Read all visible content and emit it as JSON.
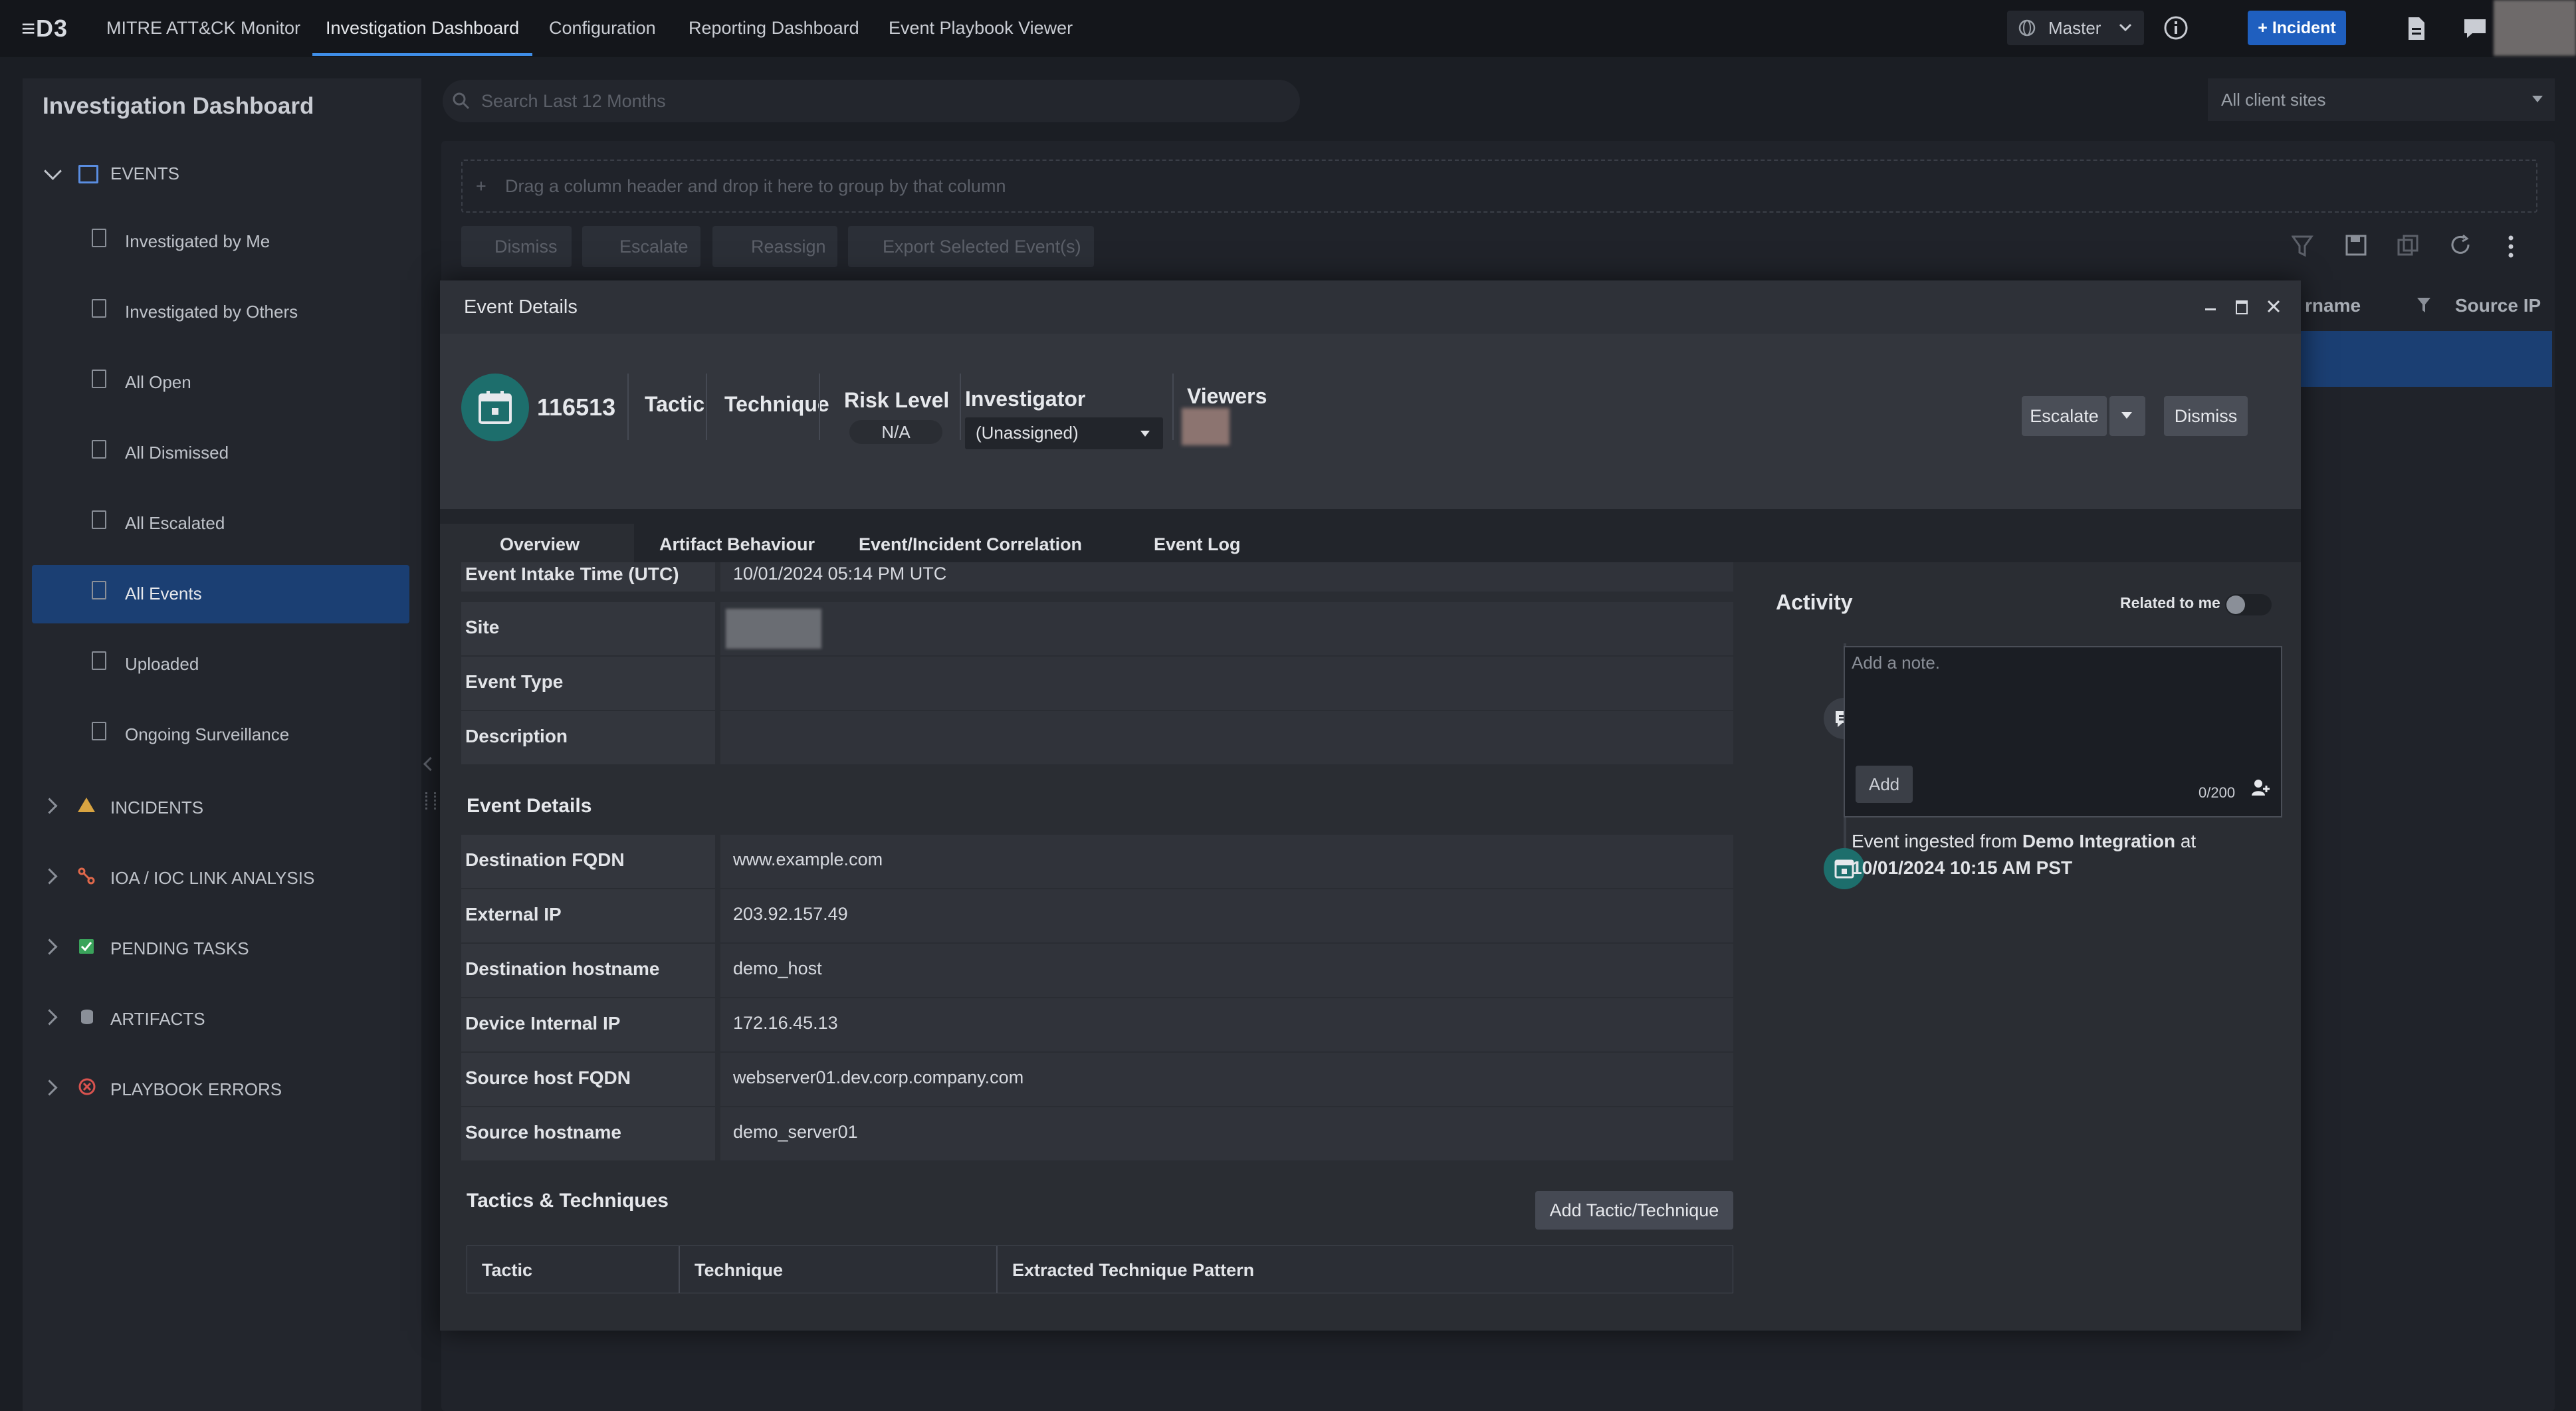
{
  "topbar": {
    "logo": "≡D3",
    "nav": [
      "MITRE ATT&CK Monitor",
      "Investigation Dashboard",
      "Configuration",
      "Reporting Dashboard",
      "Event Playbook Viewer"
    ],
    "master": "Master",
    "incident_button": "+ Incident"
  },
  "sidebar": {
    "title": "Investigation Dashboard",
    "events_section": "EVENTS",
    "items": [
      "Investigated by Me",
      "Investigated by Others",
      "All Open",
      "All Dismissed",
      "All Escalated",
      "All Events",
      "Uploaded",
      "Ongoing Surveillance"
    ],
    "sections": [
      "INCIDENTS",
      "IOA / IOC LINK ANALYSIS",
      "PENDING TASKS",
      "ARTIFACTS",
      "PLAYBOOK ERRORS"
    ]
  },
  "main": {
    "search_placeholder": "Search Last 12 Months",
    "client_sites": "All client sites",
    "dropzone": "Drag a column header and drop it here to group by that column",
    "toolbar": [
      "Dismiss",
      "Escalate",
      "Reassign",
      "Export Selected Event(s)"
    ],
    "col_headers": [
      "rname",
      "Source IP"
    ]
  },
  "modal": {
    "title": "Event Details",
    "event_id": "116513",
    "tactic_label": "Tactic",
    "technique_label": "Technique",
    "risk_label": "Risk Level",
    "risk_value": "N/A",
    "investigator_label": "Investigator",
    "investigator_value": "(Unassigned)",
    "viewers_label": "Viewers",
    "escalate": "Escalate",
    "dismiss": "Dismiss",
    "tabs": [
      "Overview",
      "Artifact Behaviour",
      "Event/Incident Correlation",
      "Event Log"
    ],
    "overview_rows": [
      {
        "label": "Event Intake Time (UTC)",
        "value": "10/01/2024 05:14 PM UTC"
      },
      {
        "label": "Site",
        "value": ""
      },
      {
        "label": "Event Type",
        "value": ""
      },
      {
        "label": "Description",
        "value": ""
      }
    ],
    "event_details_heading": "Event Details",
    "details_rows": [
      {
        "label": "Destination FQDN",
        "value": "www.example.com"
      },
      {
        "label": "External IP",
        "value": "203.92.157.49"
      },
      {
        "label": "Destination hostname",
        "value": "demo_host"
      },
      {
        "label": "Device Internal IP",
        "value": "172.16.45.13"
      },
      {
        "label": "Source host FQDN",
        "value": "webserver01.dev.corp.company.com"
      },
      {
        "label": "Source hostname",
        "value": "demo_server01"
      }
    ],
    "tt_heading": "Tactics & Techniques",
    "add_tt": "Add Tactic/Technique",
    "tt_columns": [
      "Tactic",
      "Technique",
      "Extracted Technique Pattern"
    ],
    "activity": {
      "title": "Activity",
      "related": "Related to me",
      "note_placeholder": "Add a note.",
      "add": "Add",
      "counter": "0/200",
      "ingest_prefix": "Event ingested from ",
      "ingest_source": "Demo Integration",
      "ingest_mid": " at",
      "ingest_time": "10/01/2024 10:15 AM PST"
    }
  }
}
